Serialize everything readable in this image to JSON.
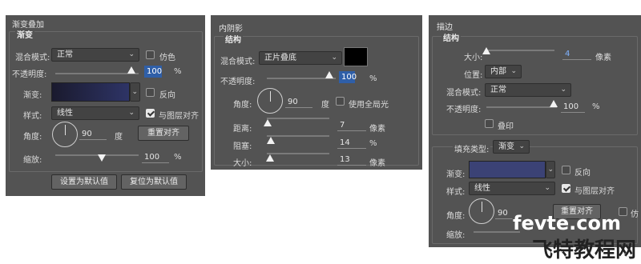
{
  "panel1": {
    "title": "渐变叠加",
    "group": "渐变",
    "blend_label": "混合模式:",
    "blend_value": "正常",
    "dither_label": "仿色",
    "opacity_label": "不透明度:",
    "opacity_value": "100",
    "opacity_unit": "%",
    "gradient_label": "渐变:",
    "reverse_label": "反向",
    "style_label": "样式:",
    "style_value": "线性",
    "align_label": "与图层对齐",
    "angle_label": "角度:",
    "angle_value": "90",
    "angle_unit": "度",
    "reset_align": "重置对齐",
    "scale_label": "缩放:",
    "scale_value": "100",
    "scale_unit": "%",
    "btn_default": "设置为默认值",
    "btn_reset": "复位为默认值"
  },
  "panel2": {
    "title": "内阴影",
    "group": "结构",
    "blend_label": "混合模式:",
    "blend_value": "正片叠底",
    "opacity_label": "不透明度:",
    "opacity_value": "100",
    "opacity_unit": "%",
    "angle_label": "角度:",
    "angle_value": "90",
    "angle_unit": "度",
    "global_light": "使用全局光",
    "distance_label": "距离:",
    "distance_value": "7",
    "distance_unit": "像素",
    "choke_label": "阻塞:",
    "choke_value": "14",
    "choke_unit": "%",
    "size_label": "大小:",
    "size_value": "13",
    "size_unit": "像素"
  },
  "panel3": {
    "title": "描边",
    "group": "结构",
    "size_label": "大小:",
    "size_value": "4",
    "size_unit": "像素",
    "position_label": "位置:",
    "position_value": "内部",
    "blend_label": "混合模式:",
    "blend_value": "正常",
    "opacity_label": "不透明度:",
    "opacity_value": "100",
    "opacity_unit": "%",
    "overprint": "叠印",
    "fill_type_label": "填充类型:",
    "fill_type_value": "渐变",
    "gradient_label": "渐变:",
    "reverse_label": "反向",
    "style_label": "样式:",
    "style_value": "线性",
    "align_label": "与图层对齐",
    "angle_label": "角度:",
    "angle_value": "90",
    "reset_align": "重置对齐",
    "dither_partial": "仿",
    "scale_label": "缩放:"
  },
  "watermark": {
    "line1": "fevte.com",
    "line2": "飞特教程网"
  },
  "colors": {
    "panel_bg": "#535353",
    "gradient_start": "#1a1a2e",
    "gradient_end": "#2e3466",
    "stroke_gradient": "#3b4275",
    "shadow_swatch": "#000000",
    "highlight": "#2f5fa8"
  },
  "icons": [
    "chevron-down-icon",
    "checkbox-icon",
    "slider-thumb-icon",
    "angle-dial-icon"
  ]
}
